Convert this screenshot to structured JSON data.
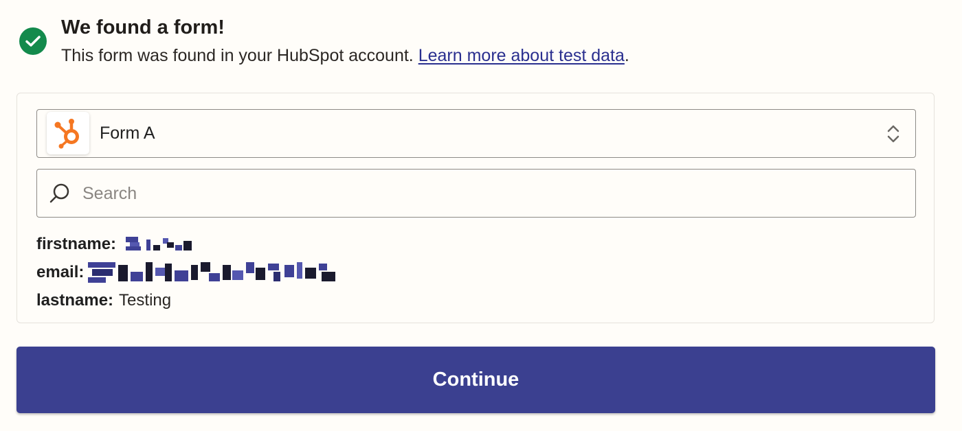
{
  "banner": {
    "title": "We found a form!",
    "description": "This form was found in your HubSpot account. ",
    "link_text": "Learn more about test data",
    "period": ".",
    "icon": "check-circle-icon",
    "success_color": "#138a4c"
  },
  "form_select": {
    "app_icon": "hubspot-icon",
    "value": "Form A",
    "icon": "up-down-chevron-icon"
  },
  "search": {
    "placeholder": "Search",
    "value": "",
    "icon": "search-icon"
  },
  "fields": [
    {
      "key": "firstname:",
      "value": "",
      "redacted": true
    },
    {
      "key": "email:",
      "value": "",
      "redacted": true
    },
    {
      "key": "lastname:",
      "value": "Testing",
      "redacted": false
    }
  ],
  "continue_button": {
    "label": "Continue",
    "color": "#3b4090"
  },
  "colors": {
    "hubspot_orange": "#f57722",
    "link": "#2a2f8f"
  }
}
